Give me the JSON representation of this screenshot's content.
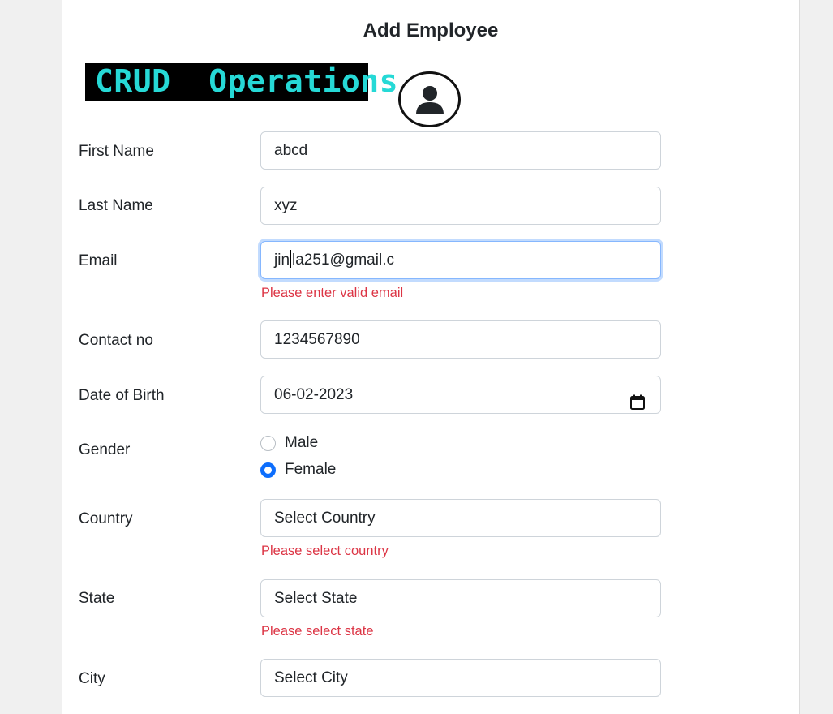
{
  "form": {
    "title": "Add Employee",
    "banner_text": "CRUD  Operations",
    "fields": {
      "first_name": {
        "label": "First Name",
        "value": "abcd"
      },
      "last_name": {
        "label": "Last Name",
        "value": "xyz"
      },
      "email": {
        "label": "Email",
        "value_before_caret": "jin",
        "value_after_caret": "la251@gmail.c",
        "error": "Please enter valid email"
      },
      "contact": {
        "label": "Contact no",
        "value": "1234567890"
      },
      "dob": {
        "label": "Date of Birth",
        "value": "06-02-2023"
      },
      "gender": {
        "label": "Gender",
        "options": [
          "Male",
          "Female"
        ],
        "selected": "Female"
      },
      "country": {
        "label": "Country",
        "value": "Select Country",
        "error": "Please select country"
      },
      "state": {
        "label": "State",
        "value": "Select State",
        "error": "Please select state"
      },
      "city": {
        "label": "City",
        "value": "Select City"
      }
    }
  },
  "colors": {
    "error": "#dc3545",
    "accent": "#0d6efd",
    "focus_border": "#86b7fe",
    "banner_bg": "#000000",
    "banner_text": "#26d9d6"
  },
  "icons": {
    "avatar": "user-circle-icon",
    "calendar": "calendar-icon"
  }
}
